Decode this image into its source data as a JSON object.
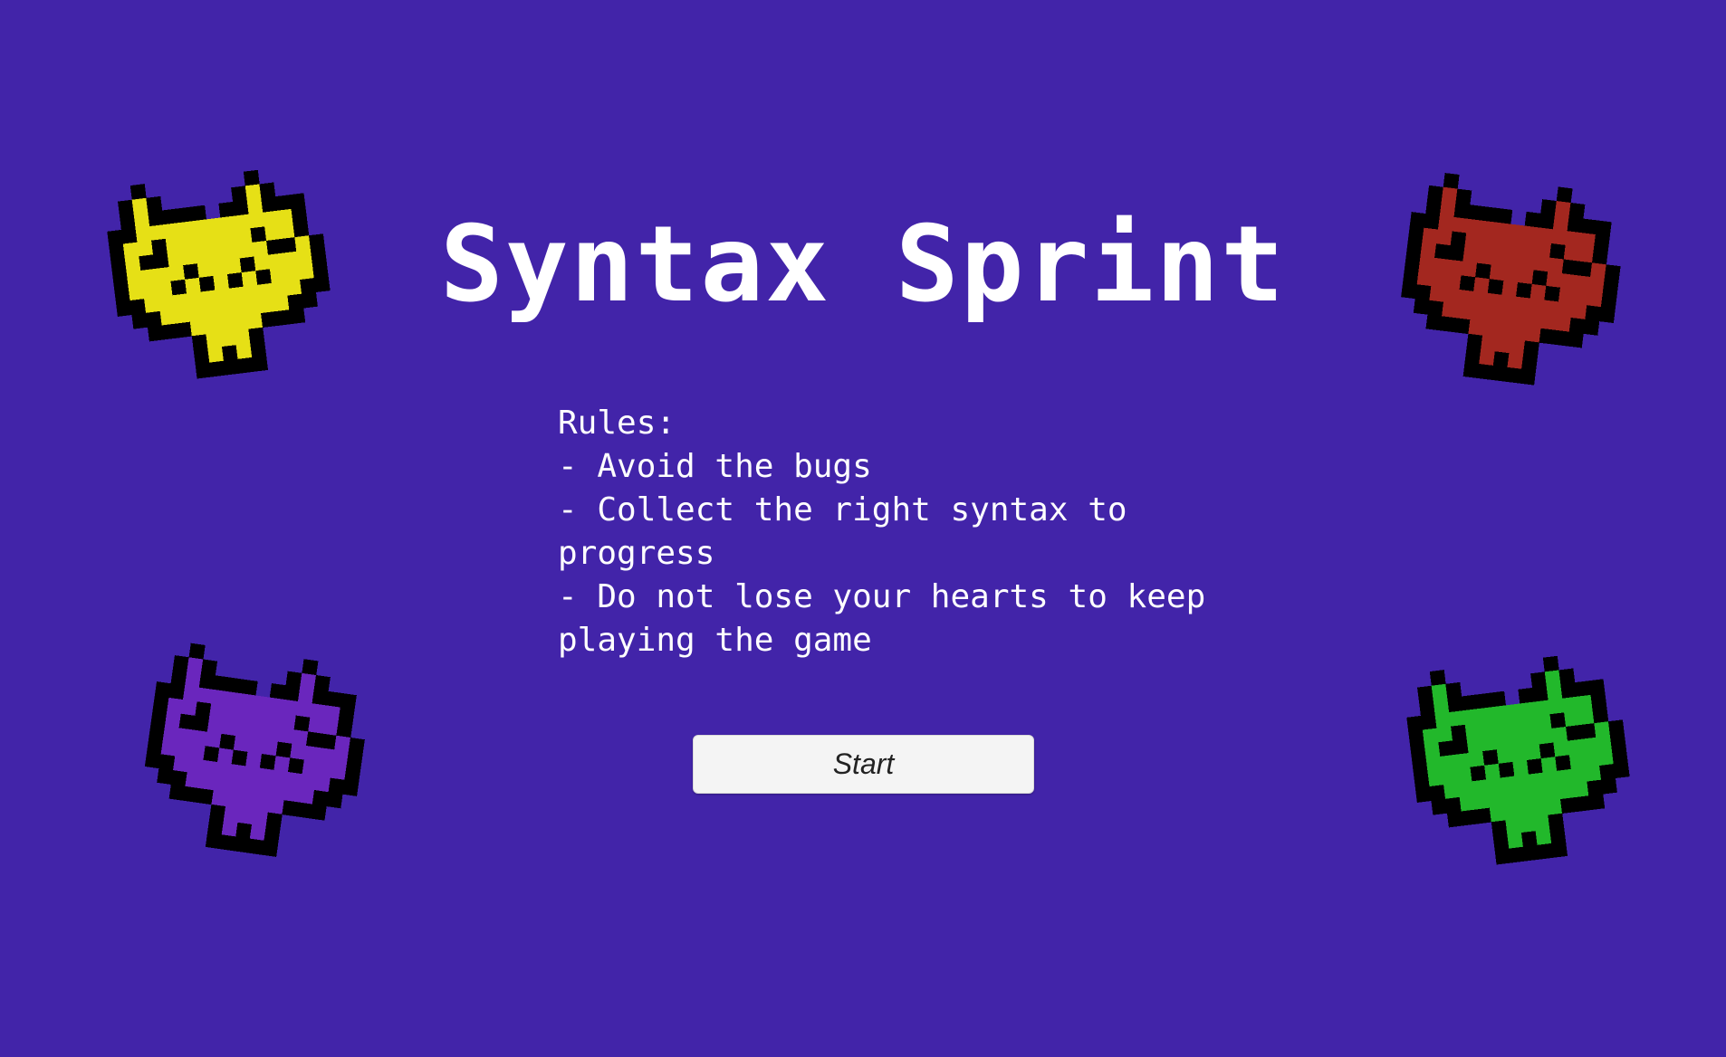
{
  "game": {
    "title": "Syntax Sprint",
    "rules": {
      "heading": "Rules:",
      "items": [
        "- Avoid the bugs",
        "- Collect the right syntax to progress",
        "- Do not lose your hearts to keep",
        "playing the game"
      ]
    },
    "start_label": "Start"
  },
  "bugs": [
    {
      "name": "yellow-bug-icon",
      "color": "#e6e016"
    },
    {
      "name": "red-bug-icon",
      "color": "#a3271f"
    },
    {
      "name": "purple-bug-icon",
      "color": "#6a26bd"
    },
    {
      "name": "green-bug-icon",
      "color": "#22b82b"
    }
  ],
  "colors": {
    "background": "#4224a9",
    "text": "#ffffff",
    "button_bg": "#f4f4f4",
    "button_text": "#232323"
  }
}
